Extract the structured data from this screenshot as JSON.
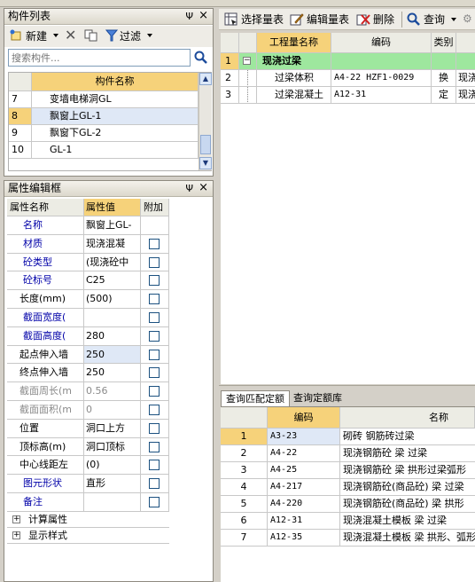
{
  "top_strip": {
    "fragments": [
      "",
      "",
      ""
    ]
  },
  "component_list": {
    "title": "构件列表",
    "pin_glyph": "Ψ",
    "close_glyph": "×",
    "new_label": "新建",
    "filter_label": "过滤",
    "search_placeholder": "搜索构件...",
    "col_name": "构件名称",
    "rows": [
      {
        "num": "7",
        "name": "变墙电梯洞GL"
      },
      {
        "num": "8",
        "name": "飘窗上GL-1"
      },
      {
        "num": "9",
        "name": "飘窗下GL-2"
      },
      {
        "num": "10",
        "name": "GL-1"
      }
    ],
    "scroll_up": "▲",
    "scroll_down": "▼"
  },
  "property_editor": {
    "title": "属性编辑框",
    "col_name": "属性名称",
    "col_value": "属性值",
    "col_extra": "附加",
    "rows": [
      {
        "name": "名称",
        "value": "飘窗上GL-",
        "style": "blue",
        "check": false
      },
      {
        "name": "材质",
        "value": "现浇混凝",
        "style": "blue",
        "check": true
      },
      {
        "name": "砼类型",
        "value": "(现浇砼中",
        "style": "blue",
        "check": true
      },
      {
        "name": "砼标号",
        "value": "C25",
        "style": "blue",
        "check": true
      },
      {
        "name": "长度(mm)",
        "value": "(500)",
        "style": "normal",
        "check": true
      },
      {
        "name": "截面宽度(",
        "value": "",
        "style": "blue",
        "check": true
      },
      {
        "name": "截面高度(",
        "value": "280",
        "style": "blue",
        "check": true
      },
      {
        "name": "起点伸入墙",
        "value": "250",
        "style": "normal",
        "check": true
      },
      {
        "name": "终点伸入墙",
        "value": "250",
        "style": "normal",
        "check": true
      },
      {
        "name": "截面周长(m",
        "value": "0.56",
        "style": "gray",
        "check": true
      },
      {
        "name": "截面面积(m",
        "value": "0",
        "style": "gray",
        "check": true
      },
      {
        "name": "位置",
        "value": "洞口上方",
        "style": "normal",
        "check": true
      },
      {
        "name": "顶标高(m)",
        "value": "洞口顶标",
        "style": "normal",
        "check": true
      },
      {
        "name": "中心线距左",
        "value": "(0)",
        "style": "normal",
        "check": true
      },
      {
        "name": "图元形状",
        "value": "直形",
        "style": "blue",
        "check": true
      },
      {
        "name": "备注",
        "value": "",
        "style": "blue",
        "check": true
      }
    ],
    "groups": [
      {
        "label": "计算属性",
        "sign": "+"
      },
      {
        "label": "显示样式",
        "sign": "+"
      }
    ]
  },
  "right_toolbar": {
    "select_label": "选择量表",
    "edit_label": "编辑量表",
    "delete_label": "删除",
    "query_label": "查询"
  },
  "quantity_table": {
    "headers": {
      "name": "工程量名称",
      "code": "编码",
      "category": "类别"
    },
    "rows": [
      {
        "num": "1",
        "expander": "−",
        "name": "现浇过梁",
        "code": "",
        "category": "",
        "extra": ""
      },
      {
        "num": "2",
        "expander": "",
        "name": "过梁体积",
        "code": "A4-22 HZF1-0029",
        "category": "换",
        "extra": "现浇"
      },
      {
        "num": "3",
        "expander": "",
        "name": "过梁混凝土",
        "code": "A12-31",
        "category": "定",
        "extra": "现浇"
      }
    ]
  },
  "bottom_tabs": {
    "tab1": "查询匹配定额",
    "tab2": "查询定额库"
  },
  "quota_table": {
    "headers": {
      "code": "编码",
      "name": "名称"
    },
    "rows": [
      {
        "num": "1",
        "code": "A3-23",
        "name": "砌砖 钢筋砖过梁"
      },
      {
        "num": "2",
        "code": "A4-22",
        "name": "现浇钢筋砼 梁 过梁"
      },
      {
        "num": "3",
        "code": "A4-25",
        "name": "现浇钢筋砼 梁 拱形过梁弧形"
      },
      {
        "num": "4",
        "code": "A4-217",
        "name": "现浇钢筋砼(商品砼) 梁 过梁"
      },
      {
        "num": "5",
        "code": "A4-220",
        "name": "现浇钢筋砼(商品砼) 梁 拱形"
      },
      {
        "num": "6",
        "code": "A12-31",
        "name": "现浇混凝土模板 梁 过梁"
      },
      {
        "num": "7",
        "code": "A12-35",
        "name": "现浇混凝土模板 梁 拱形、弧形"
      }
    ]
  },
  "colors": {
    "header_orange": "#f6d27a",
    "row_green": "#9ee79e",
    "row_selected": "#dfe8f6",
    "blue_text": "#0000a8"
  }
}
